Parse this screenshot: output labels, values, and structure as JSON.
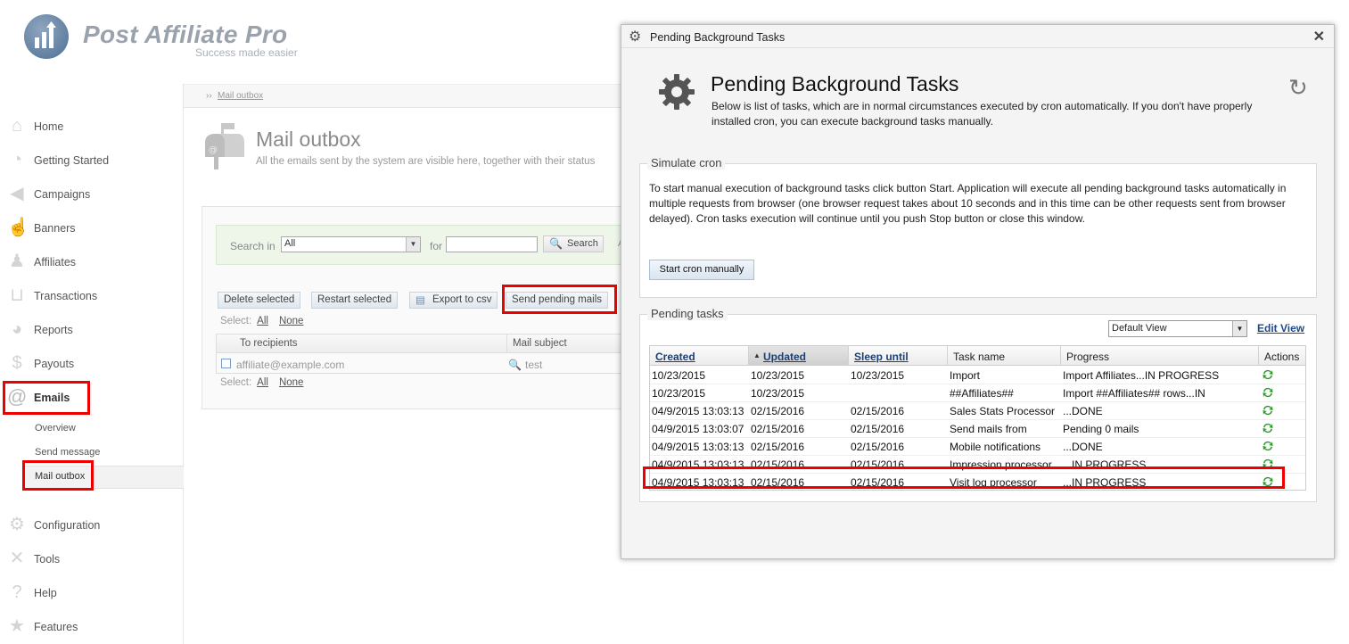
{
  "logo": {
    "title": "Post Affiliate Pro",
    "subtitle": "Success made easier"
  },
  "sidebar": {
    "items": [
      {
        "label": "Home",
        "icon": "house-icon"
      },
      {
        "label": "Getting Started",
        "icon": "stopwatch-icon"
      },
      {
        "label": "Campaigns",
        "icon": "megaphone-icon"
      },
      {
        "label": "Banners",
        "icon": "hand-icon"
      },
      {
        "label": "Affiliates",
        "icon": "people-icon"
      },
      {
        "label": "Transactions",
        "icon": "basket-icon"
      },
      {
        "label": "Reports",
        "icon": "pie-chart-icon"
      },
      {
        "label": "Payouts",
        "icon": "money-bag-icon"
      },
      {
        "label": "Emails",
        "icon": "at-icon"
      },
      {
        "label": "Configuration",
        "icon": "gear-icon"
      },
      {
        "label": "Tools",
        "icon": "wrench-icon"
      },
      {
        "label": "Help",
        "icon": "question-icon"
      },
      {
        "label": "Features",
        "icon": "star-icon"
      }
    ],
    "emails_sub": [
      "Overview",
      "Send message",
      "Mail outbox"
    ]
  },
  "breadcrumb": {
    "sep": "››",
    "current": "Mail outbox"
  },
  "page": {
    "title": "Mail outbox",
    "desc": "All the emails sent by the system are visible here, together with their status"
  },
  "search": {
    "label": "Search in",
    "scope": "All",
    "for_label": "for",
    "button": "Search",
    "extra": "A"
  },
  "toolbar": {
    "delete": "Delete selected",
    "restart": "Restart selected",
    "export": "Export to csv",
    "send_pending": "Send pending mails"
  },
  "select_line": {
    "label": "Select:",
    "all": "All",
    "none": "None"
  },
  "outbox_grid": {
    "headers": [
      "To recipients",
      "Mail subject"
    ],
    "rows": [
      {
        "recipient": "affiliate@example.com",
        "subject": "test"
      }
    ]
  },
  "dialog": {
    "bar_title": "Pending Background Tasks",
    "title": "Pending Background Tasks",
    "desc": "Below is list of tasks, which are in normal circumstances executed by cron automatically. If you don't have properly installed cron, you can execute background tasks manually.",
    "simulate_legend": "Simulate cron",
    "simulate_text": "To start manual execution of background tasks click button Start. Application will execute all pending background tasks automatically in multiple requests from browser (one browser request takes about 10 seconds and in this time can be other requests sent from browser delayed). Cron tasks execution will continue until you push Stop button or close this window.",
    "cron_button": "Start cron manually",
    "pending_legend": "Pending tasks",
    "view": "Default View",
    "edit_view": "Edit View",
    "headers": [
      "Created",
      "Updated",
      "Sleep until",
      "Task name",
      "Progress",
      "Actions"
    ],
    "tasks": [
      {
        "created": "10/23/2015",
        "updated": "10/23/2015",
        "sleep": "10/23/2015",
        "name": "Import",
        "progress": "Import Affiliates...IN PROGRESS"
      },
      {
        "created": "10/23/2015",
        "updated": "10/23/2015",
        "sleep": "",
        "name": "##Affiliates##",
        "progress": "Import ##Affiliates## rows...IN"
      },
      {
        "created": "04/9/2015 13:03:13",
        "updated": "02/15/2016",
        "sleep": "02/15/2016",
        "name": "Sales Stats Processor",
        "progress": "...DONE"
      },
      {
        "created": "04/9/2015 13:03:07",
        "updated": "02/15/2016",
        "sleep": "02/15/2016",
        "name": "Send mails from",
        "progress": "Pending 0 mails"
      },
      {
        "created": "04/9/2015 13:03:13",
        "updated": "02/15/2016",
        "sleep": "02/15/2016",
        "name": "Mobile notifications",
        "progress": "...DONE"
      },
      {
        "created": "04/9/2015 13:03:13",
        "updated": "02/15/2016",
        "sleep": "02/15/2016",
        "name": "Impression processor",
        "progress": "...IN PROGRESS"
      },
      {
        "created": "04/9/2015 13:03:13",
        "updated": "02/15/2016",
        "sleep": "02/15/2016",
        "name": "Visit log processor",
        "progress": "...IN PROGRESS"
      }
    ]
  },
  "colors": {
    "highlight": "#ee0000",
    "link": "#1b3f73",
    "action_icon": "#2e9a2e"
  }
}
